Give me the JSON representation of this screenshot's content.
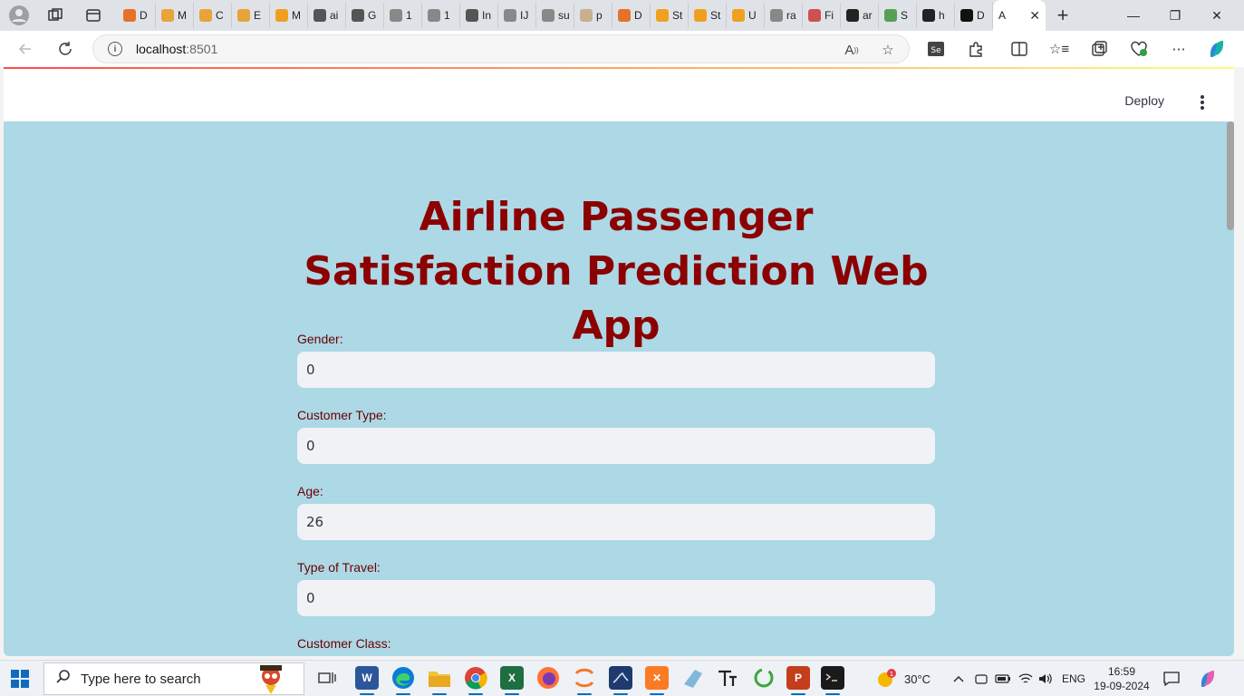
{
  "browser": {
    "tabs": [
      {
        "label": "D",
        "color": "#e6722a"
      },
      {
        "label": "M",
        "color": "#e8a33a"
      },
      {
        "label": "C",
        "color": "#e8a33a"
      },
      {
        "label": "E",
        "color": "#e8a33a"
      },
      {
        "label": "M",
        "color": "#f0a020"
      },
      {
        "label": "ai",
        "color": "#555555"
      },
      {
        "label": "G",
        "color": "#555555"
      },
      {
        "label": "1",
        "color": "#888888"
      },
      {
        "label": "1",
        "color": "#888888"
      },
      {
        "label": "In",
        "color": "#555555"
      },
      {
        "label": "IJ",
        "color": "#888888"
      },
      {
        "label": "su",
        "color": "#888888"
      },
      {
        "label": "p",
        "color": "#c8b090"
      },
      {
        "label": "D",
        "color": "#e6722a"
      },
      {
        "label": "St",
        "color": "#f0a020"
      },
      {
        "label": "St",
        "color": "#f0a020"
      },
      {
        "label": "U",
        "color": "#f0a020"
      },
      {
        "label": "ra",
        "color": "#888888"
      },
      {
        "label": "Fi",
        "color": "#d05050"
      },
      {
        "label": "ar",
        "color": "#222222"
      },
      {
        "label": "S",
        "color": "#55a055"
      },
      {
        "label": "h",
        "color": "#222222"
      },
      {
        "label": "D",
        "color": "#111111"
      }
    ],
    "active_tab": {
      "label": "A",
      "close": "✕"
    },
    "new_tab": "+",
    "window_controls": {
      "minimize": "—",
      "restore": "❐",
      "close": "✕"
    },
    "address": {
      "host": "localhost",
      "port": ":8501"
    }
  },
  "app": {
    "deploy_label": "Deploy",
    "title": "Airline Passenger Satisfaction Prediction Web App",
    "fields": [
      {
        "label": "Gender:",
        "value": "0"
      },
      {
        "label": "Customer Type:",
        "value": "0"
      },
      {
        "label": "Age:",
        "value": "26"
      },
      {
        "label": "Type of Travel:",
        "value": "0"
      },
      {
        "label": "Customer Class:",
        "value": ""
      }
    ]
  },
  "taskbar": {
    "search_placeholder": "Type here to search",
    "weather": "30°C",
    "language": "ENG",
    "time": "16:59",
    "date": "19-09-2024"
  }
}
